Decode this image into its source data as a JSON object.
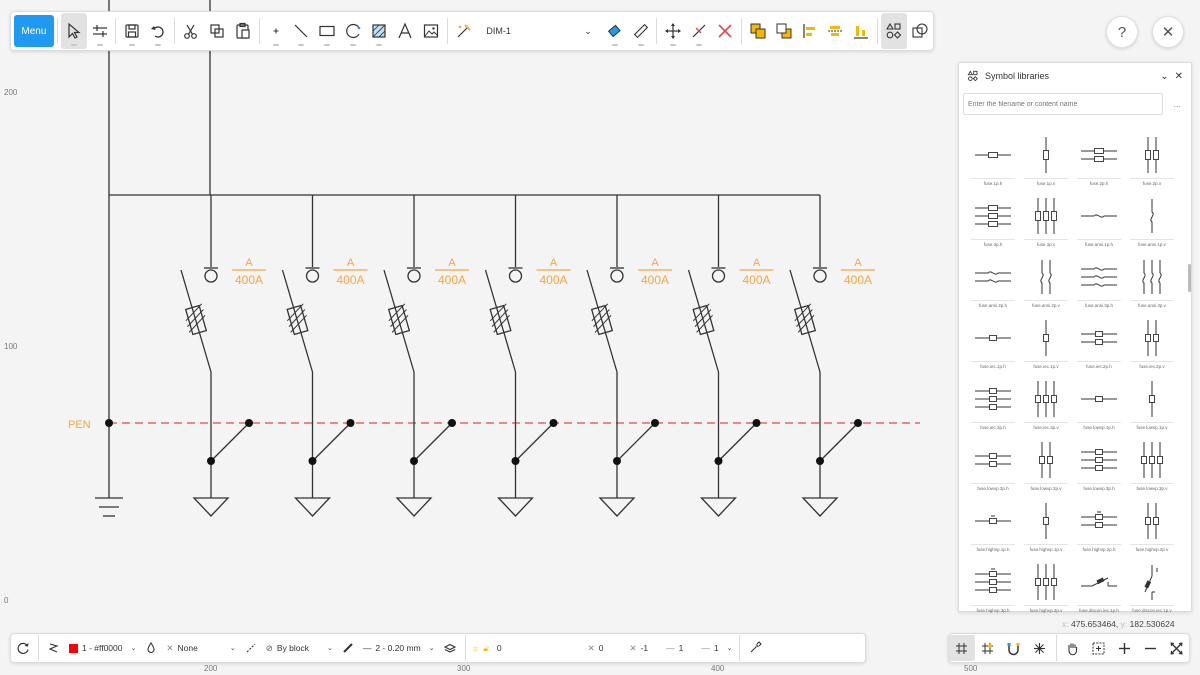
{
  "toolbar": {
    "menu_label": "Menu",
    "dimstyle_value": "DIM-1"
  },
  "help_label": "?",
  "close_label": "✕",
  "canvas": {
    "ruler_y": [
      "200",
      "100",
      "0"
    ],
    "ruler_x": [
      "200",
      "300",
      "400",
      "500"
    ],
    "pen_label": "PEN",
    "feeders": [
      {
        "phase": "A",
        "rating": "400A"
      },
      {
        "phase": "A",
        "rating": "400A"
      },
      {
        "phase": "A",
        "rating": "400A"
      },
      {
        "phase": "A",
        "rating": "400A"
      },
      {
        "phase": "A",
        "rating": "400A"
      },
      {
        "phase": "A",
        "rating": "400A"
      },
      {
        "phase": "A",
        "rating": "400A"
      }
    ],
    "colors": {
      "stroke": "#333333",
      "orange": "#f5a742",
      "pen_line": "#e24a4a"
    }
  },
  "symbol_panel": {
    "title": "Symbol libraries",
    "search_placeholder": "Enter the filename or content name",
    "more_label": "...",
    "symbols": [
      {
        "label": "fuse.1p.h",
        "icon": "fuse-1p-h"
      },
      {
        "label": "fuse.1p.v",
        "icon": "fuse-1p-v"
      },
      {
        "label": "fuse.2p.h",
        "icon": "fuse-2p-h"
      },
      {
        "label": "fuse.2p.v",
        "icon": "fuse-2p-v"
      },
      {
        "label": "fuse.3p.h",
        "icon": "fuse-3p-h"
      },
      {
        "label": "fuse.3p.v",
        "icon": "fuse-3p-v"
      },
      {
        "label": "fuse.ansi.1p.h",
        "icon": "fuse-ansi-1p-h"
      },
      {
        "label": "fuse.ansi.1p.v",
        "icon": "fuse-ansi-1p-v"
      },
      {
        "label": "fuse.ansi.2p.h",
        "icon": "fuse-ansi-2p-h"
      },
      {
        "label": "fuse.ansi.2p.v",
        "icon": "fuse-ansi-2p-v"
      },
      {
        "label": "fuse.ansi.3p.h",
        "icon": "fuse-ansi-3p-h"
      },
      {
        "label": "fuse.ansi.3p.v",
        "icon": "fuse-ansi-3p-v"
      },
      {
        "label": "fuse.iec.1p.h",
        "icon": "fuse-iec-1p-h"
      },
      {
        "label": "fuse.iec.1p.v",
        "icon": "fuse-iec-1p-v"
      },
      {
        "label": "fuse.iec.2p.h",
        "icon": "fuse-iec-2p-h"
      },
      {
        "label": "fuse.iec.2p.v",
        "icon": "fuse-iec-2p-v"
      },
      {
        "label": "fuse.iec.3p.h",
        "icon": "fuse-iec-3p-h"
      },
      {
        "label": "fuse.iec.3p.v",
        "icon": "fuse-iec-3p-v"
      },
      {
        "label": "fuse.lowvp.1p.h",
        "icon": "fuse-lowvp-1p-h"
      },
      {
        "label": "fuse.lowvp.1p.v",
        "icon": "fuse-lowvp-1p-v"
      },
      {
        "label": "fuse.lowvp.2p.h",
        "icon": "fuse-lowvp-2p-h"
      },
      {
        "label": "fuse.lowvp.2p.v",
        "icon": "fuse-lowvp-2p-v"
      },
      {
        "label": "fuse.lowvp.3p.h",
        "icon": "fuse-lowvp-3p-h"
      },
      {
        "label": "fuse.lowvp.3p.v",
        "icon": "fuse-lowvp-3p-v"
      },
      {
        "label": "fuse.highvp.1p.h",
        "icon": "fuse-highvp-1p-h"
      },
      {
        "label": "fuse.highvp.1p.v",
        "icon": "fuse-highvp-1p-v"
      },
      {
        "label": "fuse.highvp.2p.h",
        "icon": "fuse-highvp-2p-h"
      },
      {
        "label": "fuse.highvp.2p.v",
        "icon": "fuse-highvp-2p-v"
      },
      {
        "label": "fuse.highvp.3p.h",
        "icon": "fuse-highvp-3p-h"
      },
      {
        "label": "fuse.highvp.3p.v",
        "icon": "fuse-highvp-3p-v"
      },
      {
        "label": "fuse.discon.iec.1p.h",
        "icon": "fuse-discon-1p-h"
      },
      {
        "label": "fuse.discon.iec.1p.v",
        "icon": "fuse-discon-1p-v"
      }
    ]
  },
  "coords": {
    "x_label": "x:",
    "x_value": "475.653464,",
    "y_label": "y:",
    "y_value": "182.530624"
  },
  "bottombar": {
    "color_value": "1 - #ff0000",
    "linetype_value": "None",
    "lineweight_source": "By block",
    "lineweight_value": "2 - 0.20 mm",
    "layer_value": "0",
    "x_value": "0",
    "y_value": "-1",
    "z_value": "1"
  }
}
